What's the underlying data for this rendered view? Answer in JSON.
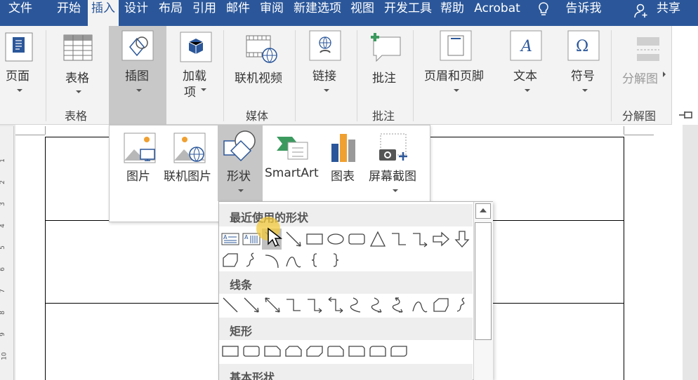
{
  "menu": {
    "items": [
      "文件",
      "开始",
      "插入",
      "设计",
      "布局",
      "引用",
      "邮件",
      "审阅",
      "新建选项",
      "视图",
      "开发工具",
      "帮助",
      "Acrobat"
    ],
    "active": "插入",
    "tell_me": "告诉我",
    "share": "共享"
  },
  "ribbon": {
    "page": "页面",
    "table": "表格",
    "illustrations": "插图",
    "addins_line1": "加载",
    "addins_line2": "项",
    "online_video": "联机视频",
    "link": "链接",
    "comment": "批注",
    "header_footer": "页眉和页脚",
    "text": "文本",
    "symbol": "符号",
    "separator": "分解图",
    "groups": {
      "table": "表格",
      "media": "媒体",
      "comment": "批注",
      "separator": "分解图"
    }
  },
  "illustrations_menu": {
    "picture": "图片",
    "online_picture": "联机图片",
    "shapes": "形状",
    "smartart": "SmartArt",
    "chart": "图表",
    "screenshot": "屏幕截图"
  },
  "gallery": {
    "sections": [
      "最近使用的形状",
      "线条",
      "矩形",
      "基本形状"
    ]
  },
  "ruler": [
    "1",
    "2",
    "3",
    "4",
    "5",
    "6",
    "7",
    "8",
    "9",
    "10"
  ],
  "colors": {
    "accent": "#2b579a",
    "ribbon": "#f3f3f3",
    "pressed": "#c8c8c8"
  }
}
